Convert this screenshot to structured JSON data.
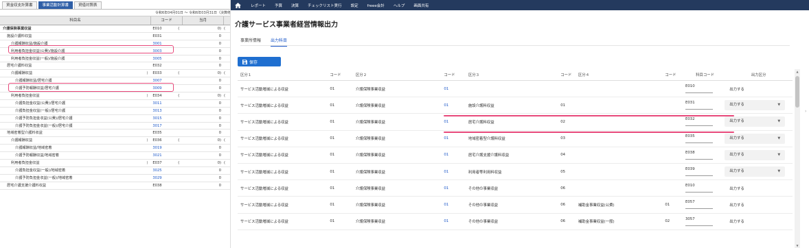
{
  "left_panel": {
    "tabs": [
      "資金収支計算書",
      "事業活動計算書",
      "貸借対照表"
    ],
    "active_tab": 1,
    "period": "令和6年04月01日 ～ 令和6年03月31日（決算修正）",
    "columns": [
      "科目名",
      "コード",
      "当月"
    ],
    "rows": [
      {
        "name": "介護保険事業収益",
        "mark": "",
        "code": "E010",
        "open": "(",
        "amount": "0)",
        "end": "(",
        "bold": true,
        "indent": 0,
        "code_blue": false
      },
      {
        "name": "施設介護料収益",
        "mark": "",
        "code": "E031",
        "open": "",
        "amount": "0",
        "end": "",
        "bold": false,
        "indent": 1,
        "code_blue": false
      },
      {
        "name": "介護報酬収益/施設介護",
        "mark": "",
        "code": "3001",
        "open": "",
        "amount": "0",
        "end": "",
        "bold": false,
        "indent": 2,
        "code_blue": true
      },
      {
        "name": "利用者負担金収益(公費)/施設介護",
        "mark": "",
        "code": "3003",
        "open": "",
        "amount": "0",
        "end": "",
        "bold": false,
        "indent": 2,
        "code_blue": true
      },
      {
        "name": "利用者負担金収益(一般)/施設介護",
        "mark": "",
        "code": "3005",
        "open": "",
        "amount": "0",
        "end": "",
        "bold": false,
        "indent": 2,
        "code_blue": true
      },
      {
        "name": "居宅介護料収益",
        "mark": "",
        "code": "E032",
        "open": "",
        "amount": "0",
        "end": "",
        "bold": false,
        "indent": 1,
        "code_blue": false
      },
      {
        "name": "介護報酬収益",
        "mark": ")",
        "code": "E033",
        "open": "(",
        "amount": "0)",
        "end": "(",
        "bold": false,
        "indent": 2,
        "code_blue": false
      },
      {
        "name": "介護報酬収益/居宅介護",
        "mark": "",
        "code": "3007",
        "open": "",
        "amount": "0",
        "end": "",
        "bold": false,
        "indent": 3,
        "code_blue": true
      },
      {
        "name": "介護予防報酬収益/居宅介護",
        "mark": "",
        "code": "3009",
        "open": "",
        "amount": "0",
        "end": "",
        "bold": false,
        "indent": 3,
        "code_blue": true
      },
      {
        "name": "利用者負担金収益",
        "mark": ")",
        "code": "E034",
        "open": "(",
        "amount": "0)",
        "end": "(",
        "bold": false,
        "indent": 2,
        "code_blue": false
      },
      {
        "name": "介護負担金収益(公費)/居宅介護",
        "mark": "",
        "code": "3011",
        "open": "",
        "amount": "0",
        "end": "",
        "bold": false,
        "indent": 3,
        "code_blue": true
      },
      {
        "name": "介護負担金収益(一般)/居宅介護",
        "mark": "",
        "code": "3013",
        "open": "",
        "amount": "0",
        "end": "",
        "bold": false,
        "indent": 3,
        "code_blue": true
      },
      {
        "name": "介護予防負担金収益(公費)/居宅介護",
        "mark": "",
        "code": "3015",
        "open": "",
        "amount": "0",
        "end": "",
        "bold": false,
        "indent": 3,
        "code_blue": true
      },
      {
        "name": "介護予防負担金収益(一般)/居宅介護",
        "mark": "",
        "code": "3017",
        "open": "",
        "amount": "0",
        "end": "",
        "bold": false,
        "indent": 3,
        "code_blue": true
      },
      {
        "name": "地域密着型介護料収益",
        "mark": "",
        "code": "E035",
        "open": "",
        "amount": "0",
        "end": "",
        "bold": false,
        "indent": 1,
        "code_blue": false
      },
      {
        "name": "介護報酬収益",
        "mark": ")",
        "code": "E036",
        "open": "(",
        "amount": "0)",
        "end": "(",
        "bold": false,
        "indent": 2,
        "code_blue": false
      },
      {
        "name": "介護報酬収益/地域密着",
        "mark": "",
        "code": "3019",
        "open": "",
        "amount": "0",
        "end": "",
        "bold": false,
        "indent": 3,
        "code_blue": true
      },
      {
        "name": "介護予防報酬収益/地域密着",
        "mark": "",
        "code": "3021",
        "open": "",
        "amount": "0",
        "end": "",
        "bold": false,
        "indent": 3,
        "code_blue": true
      },
      {
        "name": "利用者負担金収益",
        "mark": ")",
        "code": "E037",
        "open": "(",
        "amount": "0)",
        "end": "(",
        "bold": false,
        "indent": 2,
        "code_blue": false
      },
      {
        "name": "介護負担金収益(一般)/地域密着",
        "mark": "",
        "code": "3025",
        "open": "",
        "amount": "0",
        "end": "",
        "bold": false,
        "indent": 3,
        "code_blue": true
      },
      {
        "name": "介護予防負担金収益(一般)/地域密着",
        "mark": "",
        "code": "3029",
        "open": "",
        "amount": "0",
        "end": "",
        "bold": false,
        "indent": 3,
        "code_blue": true
      },
      {
        "name": "居宅介護支援介護料収益",
        "mark": "",
        "code": "E038",
        "open": "",
        "amount": "0",
        "end": "",
        "bold": false,
        "indent": 1,
        "code_blue": false
      }
    ]
  },
  "nav": {
    "items": [
      "レポート",
      "予算",
      "決算",
      "チェックリスト実行",
      "設定",
      "freee会計",
      "ヘルプ",
      "画面共有"
    ]
  },
  "main": {
    "title": "介護サービス事業者経営情報出力",
    "tabs": [
      "事業所情報",
      "出力科目"
    ],
    "active_tab": 1,
    "save_label": "保存",
    "columns": {
      "k1": "区分１",
      "c1": "コード",
      "k2": "区分２",
      "c2": "コード",
      "k3": "区分３",
      "c3": "コード",
      "k4": "区分４",
      "c4": "コード",
      "account_code": "科目コード",
      "output": "出力区分"
    },
    "rows": [
      {
        "k1": "サービス活動増減による収益",
        "c1": "01",
        "k2": "介護保険事業収益",
        "c2": "01",
        "k3": "",
        "c3": "",
        "k4": "",
        "c4": "",
        "code": "E010",
        "output": "出力する",
        "select": false
      },
      {
        "k1": "サービス活動増減による収益",
        "c1": "01",
        "k2": "介護保険事業収益",
        "c2": "01",
        "k3": "施設介護料収益",
        "c3": "01",
        "k4": "",
        "c4": "",
        "code": "E031",
        "output": "出力する",
        "select": true
      },
      {
        "k1": "サービス活動増減による収益",
        "c1": "01",
        "k2": "介護保険事業収益",
        "c2": "01",
        "k3": "居宅介護料収益",
        "c3": "02",
        "k4": "",
        "c4": "",
        "code": "E032",
        "output": "出力する",
        "select": true
      },
      {
        "k1": "サービス活動増減による収益",
        "c1": "01",
        "k2": "介護保険事業収益",
        "c2": "01",
        "k3": "地域密着型介護料収益",
        "c3": "03",
        "k4": "",
        "c4": "",
        "code": "E035",
        "output": "出力する",
        "select": true
      },
      {
        "k1": "サービス活動増減による収益",
        "c1": "01",
        "k2": "介護保険事業収益",
        "c2": "01",
        "k3": "居宅介護支援介護料収益",
        "c3": "04",
        "k4": "",
        "c4": "",
        "code": "E038",
        "output": "出力する",
        "select": true
      },
      {
        "k1": "サービス活動増減による収益",
        "c1": "01",
        "k2": "介護保険事業収益",
        "c2": "01",
        "k3": "利用者等利用料収益",
        "c3": "05",
        "k4": "",
        "c4": "",
        "code": "E039",
        "output": "出力する",
        "select": true
      },
      {
        "k1": "サービス活動増減による収益",
        "c1": "01",
        "k2": "介護保険事業収益",
        "c2": "01",
        "k3": "その他の事業収益",
        "c3": "06",
        "k4": "",
        "c4": "",
        "code": "E010",
        "output": "出力する",
        "select": false
      },
      {
        "k1": "サービス活動増減による収益",
        "c1": "01",
        "k2": "介護保険事業収益",
        "c2": "01",
        "k3": "その他の事業収益",
        "c3": "06",
        "k4": "補助金事業収益(公費)",
        "c4": "01",
        "code": "E057",
        "output": "出力する",
        "select": false
      },
      {
        "k1": "サービス活動増減による収益",
        "c1": "01",
        "k2": "介護保険事業収益",
        "c2": "01",
        "k3": "その他の事業収益",
        "c3": "06",
        "k4": "補助金事業収益(一般)",
        "c4": "02",
        "code": "3057",
        "output": "出力する",
        "select": false
      }
    ]
  },
  "colors": {
    "nav_bg": "#243a5e",
    "accent": "#1f6fd0",
    "highlight": "#e8487a",
    "active_left_tab": "#2f5fa7"
  },
  "icons": [
    "home-icon",
    "save-icon",
    "chevron-down-icon",
    "chevron-right-icon"
  ]
}
